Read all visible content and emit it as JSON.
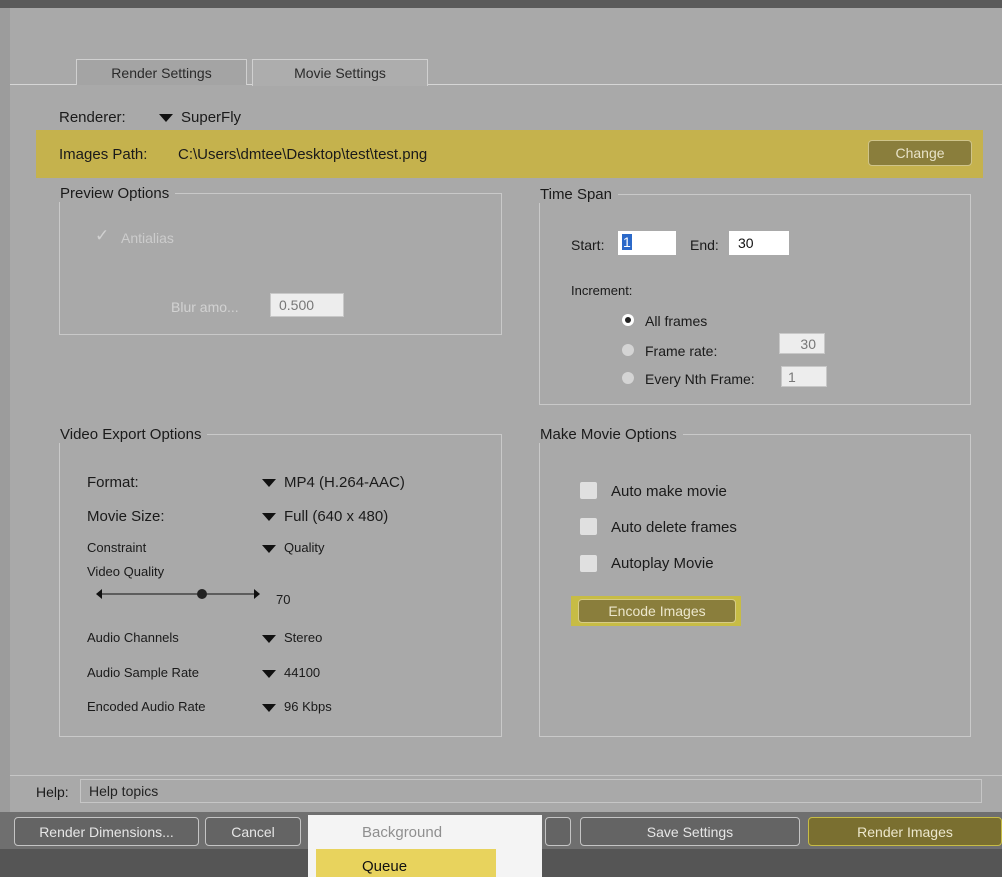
{
  "tabs": [
    {
      "label": "Render Settings"
    },
    {
      "label": "Movie Settings"
    }
  ],
  "renderer": {
    "label": "Renderer:",
    "value": "SuperFly"
  },
  "images_path": {
    "label": "Images Path:",
    "value": "C:\\Users\\dmtee\\Desktop\\test\\test.png",
    "change_button": "Change"
  },
  "preview_options": {
    "title": "Preview Options",
    "antialias_label": "Antialias",
    "blur_label": "Blur amo...",
    "blur_value": "0.500"
  },
  "time_span": {
    "title": "Time Span",
    "start_label": "Start:",
    "start_value": "1",
    "end_label": "End:",
    "end_value": "30",
    "increment_label": "Increment:",
    "options": [
      {
        "label": "All frames",
        "selected": true
      },
      {
        "label": "Frame rate:",
        "selected": false,
        "value": "30"
      },
      {
        "label": "Every Nth Frame:",
        "selected": false,
        "value": "1"
      }
    ]
  },
  "video_export": {
    "title": "Video Export Options",
    "format_label": "Format:",
    "format_value": "MP4 (H.264-AAC)",
    "movie_size_label": "Movie Size:",
    "movie_size_value": "Full (640 x 480)",
    "constraint_label": "Constraint",
    "constraint_value": "Quality",
    "video_quality_label": "Video Quality",
    "video_quality_value": "70",
    "audio_channels_label": "Audio Channels",
    "audio_channels_value": "Stereo",
    "audio_sample_rate_label": "Audio Sample Rate",
    "audio_sample_rate_value": "44100",
    "encoded_audio_rate_label": "Encoded Audio Rate",
    "encoded_audio_rate_value": "96 Kbps"
  },
  "make_movie": {
    "title": "Make Movie Options",
    "auto_make_movie": "Auto make movie",
    "auto_delete_frames": "Auto delete frames",
    "autoplay_movie": "Autoplay Movie",
    "encode_button": "Encode Images"
  },
  "help": {
    "label": "Help:",
    "value": "Help topics"
  },
  "bottom_buttons": {
    "render_dimensions": "Render Dimensions...",
    "cancel": "Cancel",
    "save_settings": "Save Settings",
    "render_images": "Render Images"
  },
  "menu": {
    "background": "Background",
    "queue": "Queue"
  },
  "colors": {
    "accent": "#c5b24d",
    "highlight": "#e8d35d"
  }
}
